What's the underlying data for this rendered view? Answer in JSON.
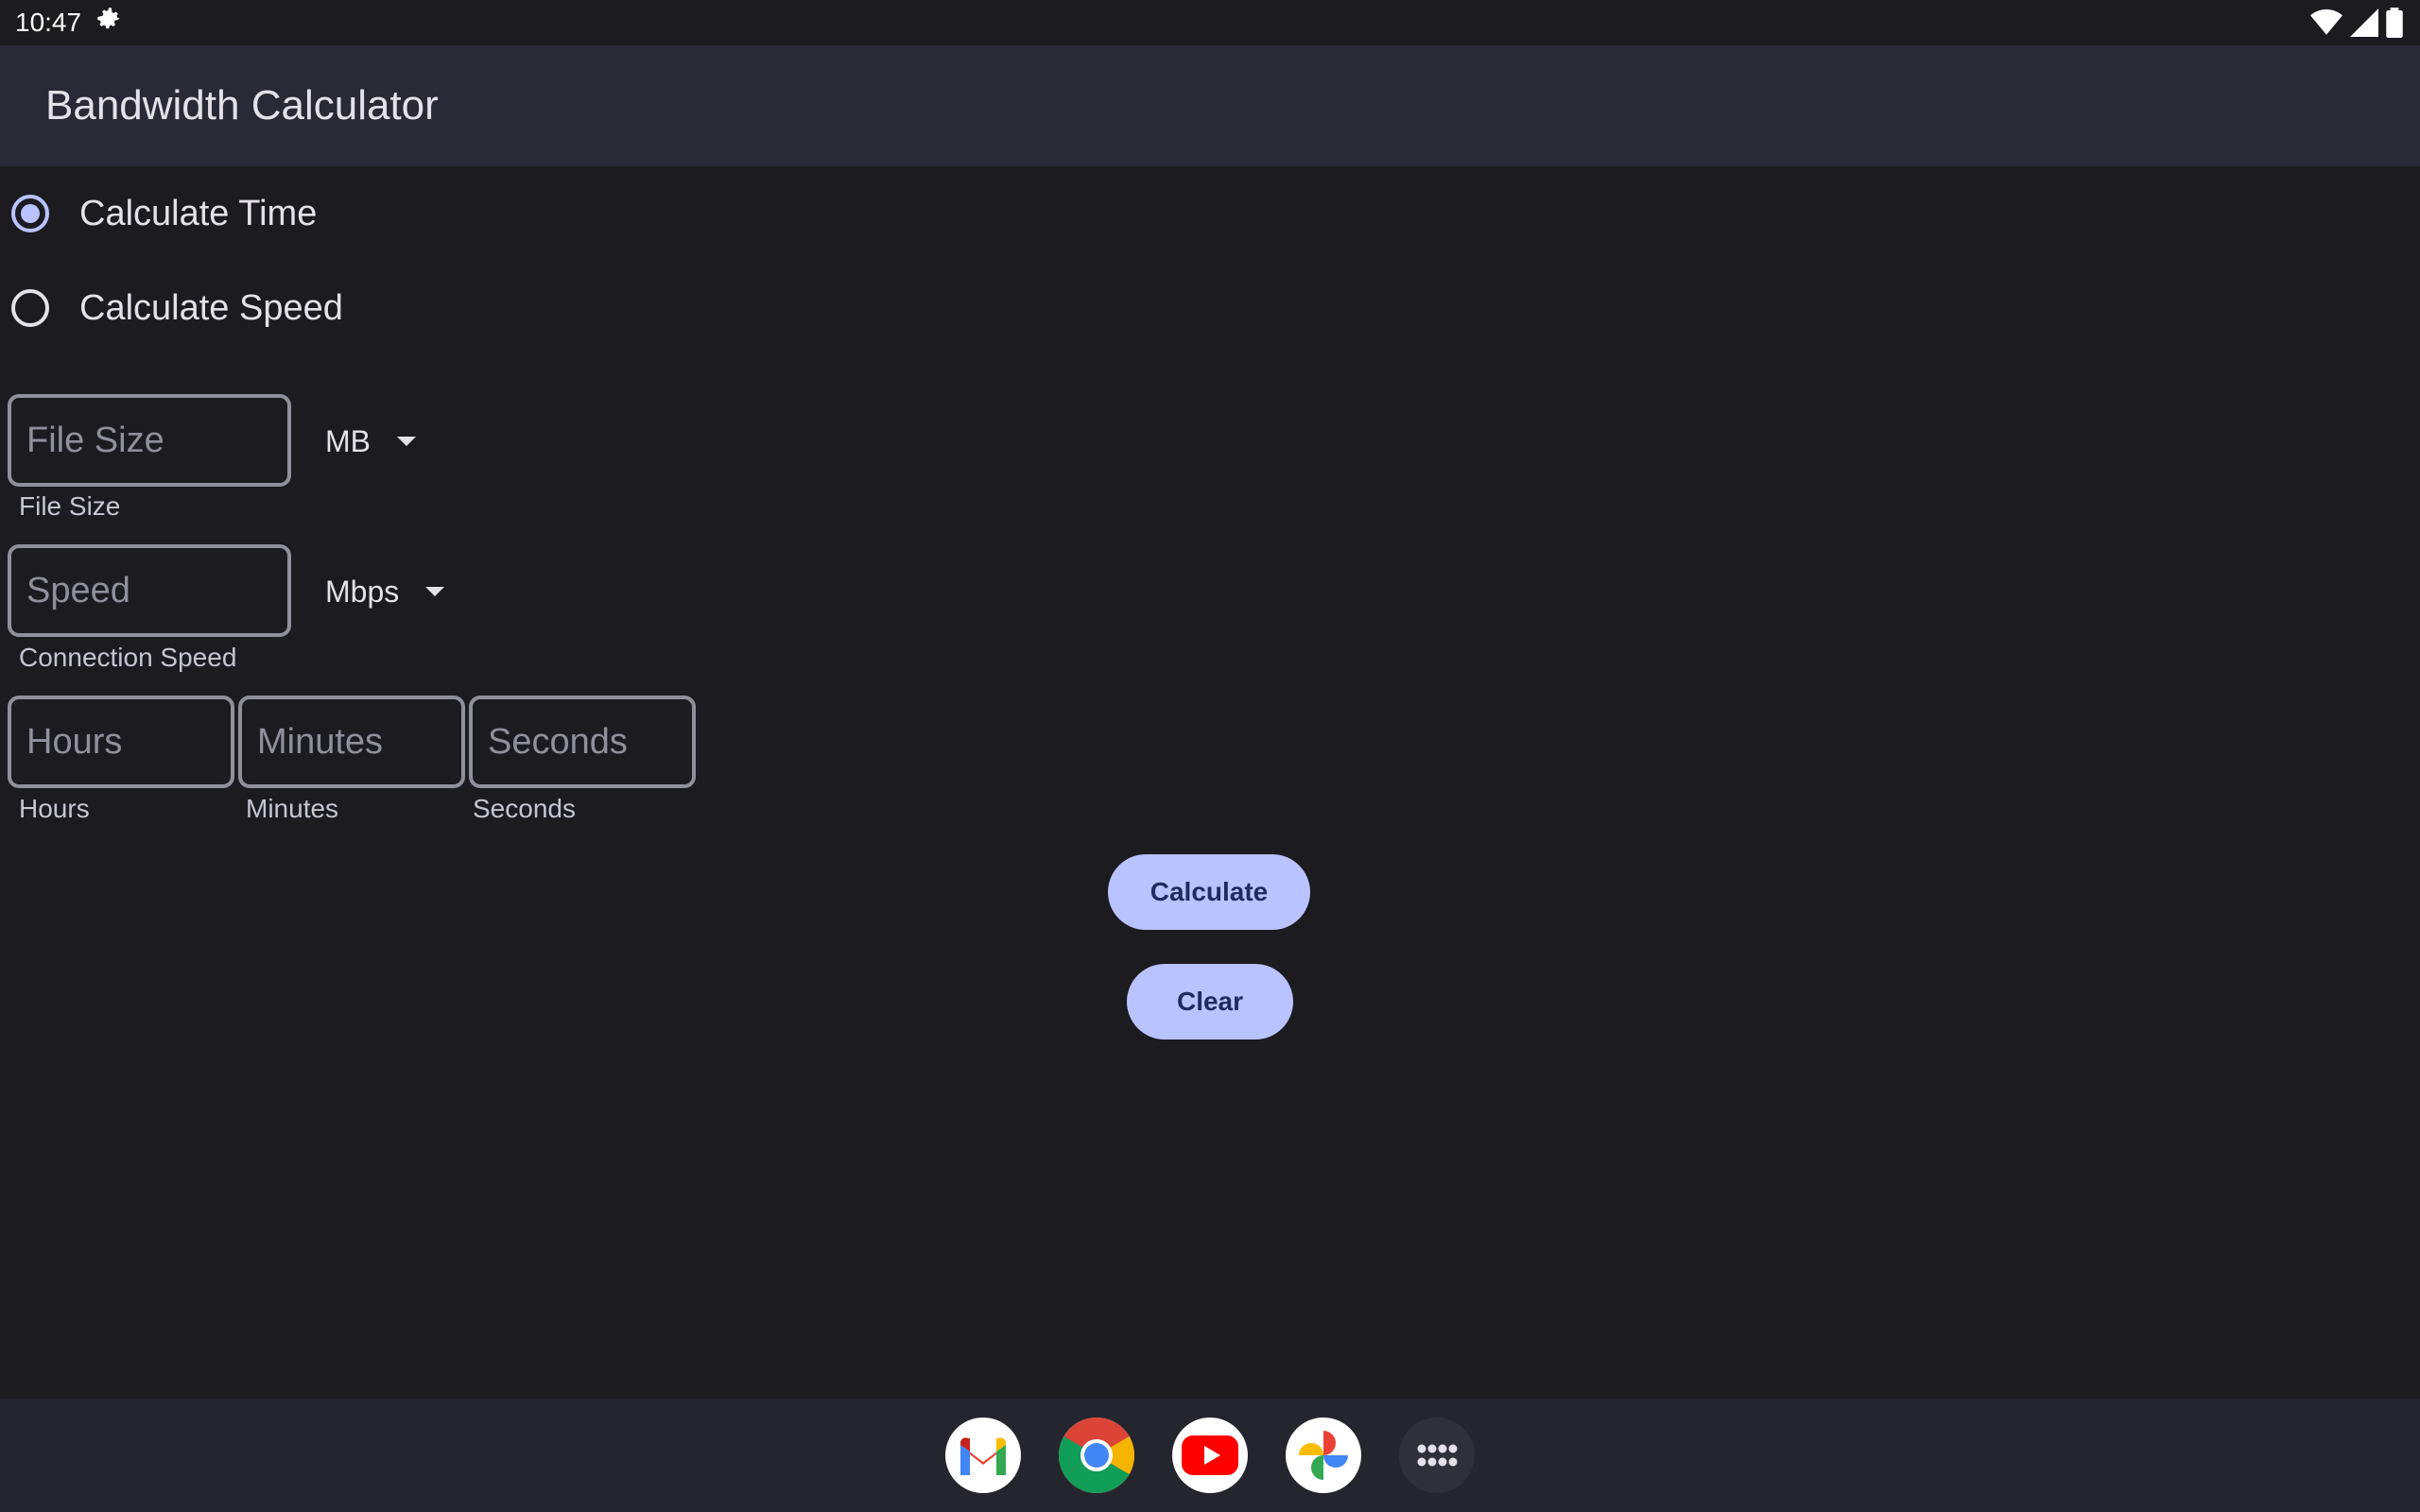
{
  "status": {
    "time": "10:47"
  },
  "app": {
    "title": "Bandwidth Calculator"
  },
  "mode": {
    "options": [
      {
        "label": "Calculate Time",
        "checked": true
      },
      {
        "label": "Calculate Speed",
        "checked": false
      }
    ]
  },
  "file_size": {
    "placeholder": "File Size",
    "helper": "File Size",
    "unit": "MB"
  },
  "speed": {
    "placeholder": "Speed",
    "helper": "Connection Speed",
    "unit": "Mbps"
  },
  "time": {
    "hours": {
      "placeholder": "Hours",
      "helper": "Hours"
    },
    "minutes": {
      "placeholder": "Minutes",
      "helper": "Minutes"
    },
    "seconds": {
      "placeholder": "Seconds",
      "helper": "Seconds"
    }
  },
  "buttons": {
    "calculate": "Calculate",
    "clear": "Clear"
  },
  "colors": {
    "accent": "#b9c3ff",
    "background": "#1b1b20",
    "app_bar": "#292a35",
    "outline": "#8f909a"
  },
  "taskbar": {
    "icons": [
      "gmail-icon",
      "chrome-icon",
      "youtube-icon",
      "photos-icon",
      "app-drawer-icon"
    ]
  }
}
